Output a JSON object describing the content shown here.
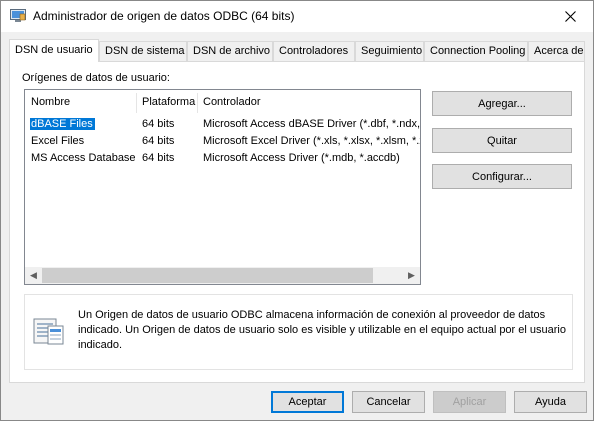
{
  "window": {
    "title": "Administrador de origen de datos ODBC (64 bits)",
    "close_glyph": "✕"
  },
  "tabs": [
    {
      "label": "DSN de usuario",
      "active": true
    },
    {
      "label": "DSN de sistema",
      "active": false
    },
    {
      "label": "DSN de archivo",
      "active": false
    },
    {
      "label": "Controladores",
      "active": false
    },
    {
      "label": "Seguimiento",
      "active": false
    },
    {
      "label": "Connection Pooling",
      "active": false
    },
    {
      "label": "Acerca de",
      "active": false
    }
  ],
  "user_dsn": {
    "group_label": "Orígenes de datos de usuario:",
    "columns": [
      "Nombre",
      "Plataforma",
      "Controlador"
    ],
    "rows": [
      {
        "name": "dBASE Files",
        "platform": "64 bits",
        "driver": "Microsoft Access dBASE Driver (*.dbf, *.ndx, *.mdx)",
        "selected": true
      },
      {
        "name": "Excel Files",
        "platform": "64 bits",
        "driver": "Microsoft Excel Driver (*.xls, *.xlsx, *.xlsm, *.xlsb)",
        "selected": false
      },
      {
        "name": "MS Access Database",
        "platform": "64 bits",
        "driver": "Microsoft Access Driver (*.mdb, *.accdb)",
        "selected": false
      }
    ],
    "scroll_left": "◀",
    "scroll_right": "▶"
  },
  "side_buttons": {
    "add": "Agregar...",
    "remove": "Quitar",
    "configure": "Configurar..."
  },
  "info": {
    "text": "Un Origen de datos de usuario ODBC almacena información de conexión al proveedor de datos indicado. Un Origen de datos de usuario solo es visible y utilizable en el equipo actual por el usuario indicado.",
    "icon": "data-source-icon"
  },
  "footer_buttons": {
    "ok": "Aceptar",
    "cancel": "Cancelar",
    "apply": "Aplicar",
    "help": "Ayuda"
  },
  "colors": {
    "selection": "#0078d7",
    "default_button_border": "#0078d7",
    "dialog_bg": "#f0f0f0"
  }
}
